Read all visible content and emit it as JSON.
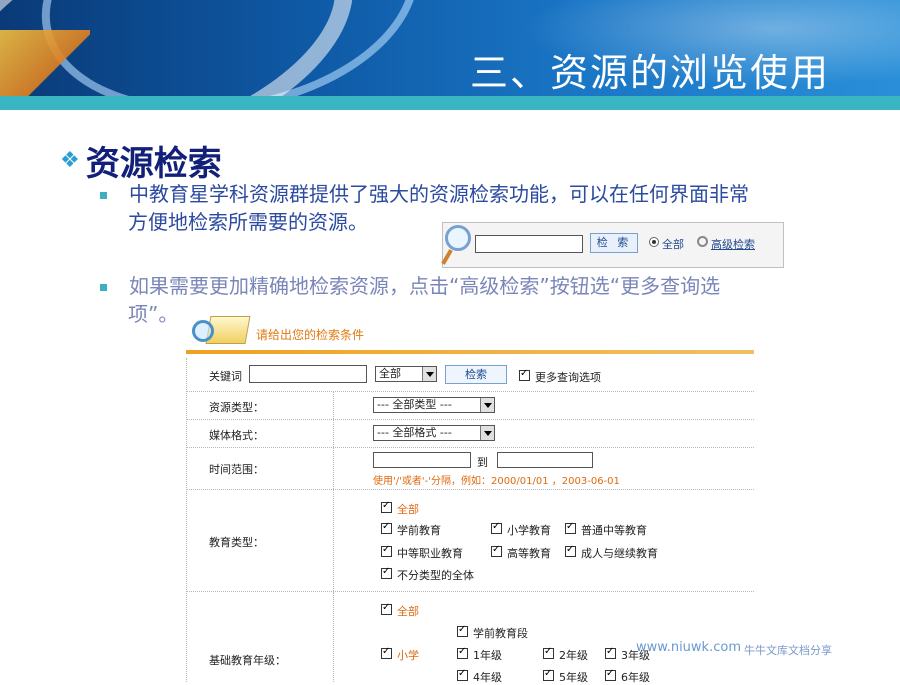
{
  "header": {
    "title": "三、资源的浏览使用"
  },
  "section": {
    "title": "资源检索",
    "bullet1_line1": "中教育星学科资源群提供了强大的资源检索功能，可以在任何界面非常",
    "bullet1_line2": "方便地检索所需要的资源。",
    "bullet2_line1": "如果需要更加精确地检索资源，点击“高级检索”按钮选“更多查询选",
    "bullet2_line2": "项”。"
  },
  "search_widget": {
    "button": "检 索",
    "radio_all": "全部",
    "advanced_link": "高级检索"
  },
  "form": {
    "title": "请给出您的检索条件",
    "keyword_label": "关键词",
    "keyword_scope": "全部",
    "search_button": "检索",
    "more_options": "更多查询选项",
    "resource_type_label": "资源类型：",
    "resource_type_value": "--- 全部类型 ---",
    "media_format_label": "媒体格式：",
    "media_format_value": "--- 全部格式 ---",
    "time_range_label": "时间范围：",
    "time_to": "到",
    "time_hint": "使用'/'或者'-'分隔，例如：2000/01/01 ，2003-06-01",
    "edu_type_label": "教育类型：",
    "edu_all": "全部",
    "edu_preschool": "学前教育",
    "edu_primary": "小学教育",
    "edu_secondary": "普通中等教育",
    "edu_vocational": "中等职业教育",
    "edu_higher": "高等教育",
    "edu_adult": "成人与继续教育",
    "edu_unclassified": "不分类型的全体",
    "grade_label": "基础教育年级：",
    "grade_all": "全部",
    "grade_preschool_stage": "学前教育段",
    "grade_primary": "小学",
    "grade_1": "1年级",
    "grade_2": "2年级",
    "grade_3": "3年级",
    "grade_4": "4年级",
    "grade_5": "5年级",
    "grade_6": "6年级"
  },
  "watermark": {
    "site": "www.niuwk.com",
    "text": "牛牛文库文档分享"
  }
}
